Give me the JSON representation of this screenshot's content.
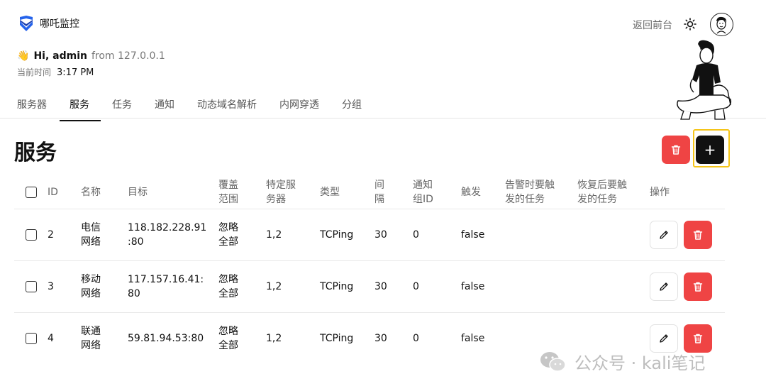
{
  "brand": {
    "name": "哪吒监控"
  },
  "header": {
    "back_label": "返回前台"
  },
  "greeting": {
    "wave": "👋",
    "hi": "Hi, admin",
    "from": "from 127.0.0.1",
    "time_label": "当前时间",
    "time_value": "3:17 PM"
  },
  "tabs": [
    {
      "label": "服务器"
    },
    {
      "label": "服务"
    },
    {
      "label": "任务"
    },
    {
      "label": "通知"
    },
    {
      "label": "动态域名解析"
    },
    {
      "label": "内网穿透"
    },
    {
      "label": "分组"
    }
  ],
  "active_tab": "服务",
  "page": {
    "title": "服务",
    "add_label": "+"
  },
  "table": {
    "headers": {
      "id": "ID",
      "name": "名称",
      "target": "目标",
      "cover_1": "覆盖",
      "cover_2": "范围",
      "servers_1": "特定服",
      "servers_2": "务器",
      "type": "类型",
      "interval_1": "间",
      "interval_2": "隔",
      "notify_1": "通知",
      "notify_2": "组ID",
      "trigger": "触发",
      "alert_1": "告警时要触",
      "alert_2": "发的任务",
      "recover_1": "恢复后要触",
      "recover_2": "发的任务",
      "actions": "操作"
    },
    "rows": [
      {
        "id": "2",
        "name_1": "电信",
        "name_2": "网络",
        "target_1": "118.182.228.91",
        "target_2": ":80",
        "cover_1": "忽略",
        "cover_2": "全部",
        "servers": "1,2",
        "type": "TCPing",
        "interval": "30",
        "notify": "0",
        "trigger": "false"
      },
      {
        "id": "3",
        "name_1": "移动",
        "name_2": "网络",
        "target_1": "117.157.16.41:",
        "target_2": "80",
        "cover_1": "忽略",
        "cover_2": "全部",
        "servers": "1,2",
        "type": "TCPing",
        "interval": "30",
        "notify": "0",
        "trigger": "false"
      },
      {
        "id": "4",
        "name_1": "联通",
        "name_2": "网络",
        "target_1": "59.81.94.53:80",
        "target_2": "",
        "cover_1": "忽略",
        "cover_2": "全部",
        "servers": "1,2",
        "type": "TCPing",
        "interval": "30",
        "notify": "0",
        "trigger": "false"
      }
    ]
  },
  "watermark": {
    "text": "公众号 · kali笔记"
  },
  "colors": {
    "danger": "#ef4444",
    "primary": "#111111",
    "highlight": "#f5c518"
  },
  "icons": {
    "logo": "shield-check-icon",
    "theme": "sun-icon",
    "delete": "trash-icon",
    "edit": "pencil-icon",
    "wechat": "wechat-icon"
  }
}
